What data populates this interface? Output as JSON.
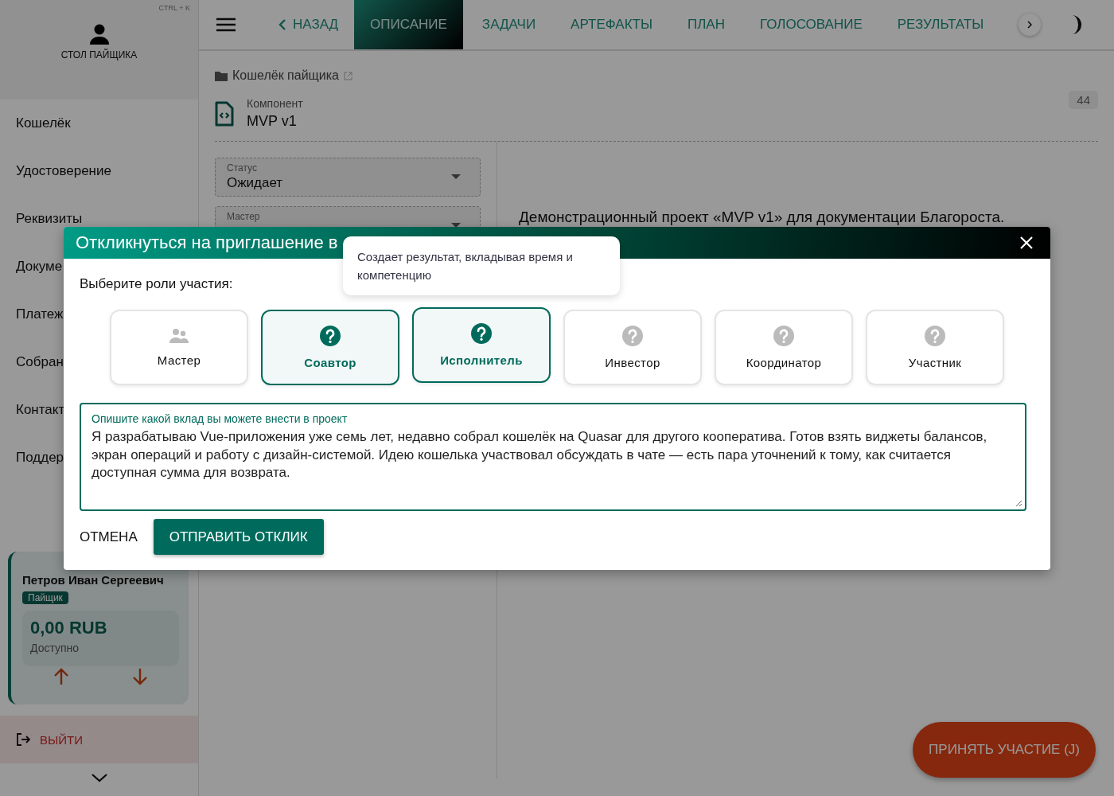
{
  "sidebar": {
    "shortcut": "CTRL + K",
    "header_title": "СТОЛ ПАЙЩИКА",
    "items": [
      {
        "label": "Кошелёк"
      },
      {
        "label": "Удостоверение"
      },
      {
        "label": "Реквизиты"
      },
      {
        "label": "Докуме"
      },
      {
        "label": "Платеж"
      },
      {
        "label": "Собран"
      },
      {
        "label": "Контакт"
      },
      {
        "label": "Поддер"
      }
    ],
    "account": {
      "name": "Петров Иван Сергеевич",
      "role": "Пайщик",
      "balance": "0,00 RUB",
      "balance_label": "Доступно"
    },
    "logout": "ВЫЙТИ"
  },
  "tabs": [
    {
      "label": "НАЗАД",
      "kind": "back",
      "selected": false
    },
    {
      "label": "ОПИСАНИЕ",
      "kind": "tab",
      "selected": true
    },
    {
      "label": "ЗАДАЧИ",
      "kind": "tab",
      "selected": false
    },
    {
      "label": "АРТЕФАКТЫ",
      "kind": "tab",
      "selected": false
    },
    {
      "label": "ПЛАН",
      "kind": "tab",
      "selected": false
    },
    {
      "label": "ГОЛОСОВАНИЕ",
      "kind": "tab",
      "selected": false
    },
    {
      "label": "РЕЗУЛЬТАТЫ",
      "kind": "tab",
      "selected": false
    }
  ],
  "breadcrumb": "Кошелёк пайщика",
  "component": {
    "type_label": "Компонент",
    "title": "MVP v1",
    "count": "44"
  },
  "fields": [
    {
      "label": "Статус",
      "value": "Ожидает"
    },
    {
      "label": "Мастер"
    }
  ],
  "description": "Демонстрационный проект «MVP v1» для документации Благороста.",
  "fab": "ПРИНЯТЬ УЧАСТИЕ (J)",
  "dialog": {
    "title": "Откликнуться на приглашение в",
    "prompt": "Выберите роли участия:",
    "roles": [
      {
        "label": "Мастер",
        "kind": "group",
        "selected": false
      },
      {
        "label": "Соавтор",
        "kind": "help",
        "selected": true
      },
      {
        "label": "Исполнитель",
        "kind": "help",
        "selected": true
      },
      {
        "label": "Инвестор",
        "kind": "help",
        "selected": false
      },
      {
        "label": "Координатор",
        "kind": "help",
        "selected": false
      },
      {
        "label": "Участник",
        "kind": "help",
        "selected": false
      }
    ],
    "field": {
      "label": "Опишите какой вклад вы можете внести в проект",
      "value": "Я разрабатываю Vue-приложения уже семь лет, недавно собрал кошелёк на Quasar для другого кооператива. Готов взять виджеты балансов, экран операций и работу с дизайн-системой. Идею кошелька участвовал обсуждать в чате — есть пара уточнений к тому, как считается доступная сумма для возврата."
    },
    "cancel": "ОТМЕНА",
    "submit": "ОТПРАВИТЬ ОТКЛИК",
    "tooltip": "Создает результат, вкладывая время и компетенцию"
  }
}
